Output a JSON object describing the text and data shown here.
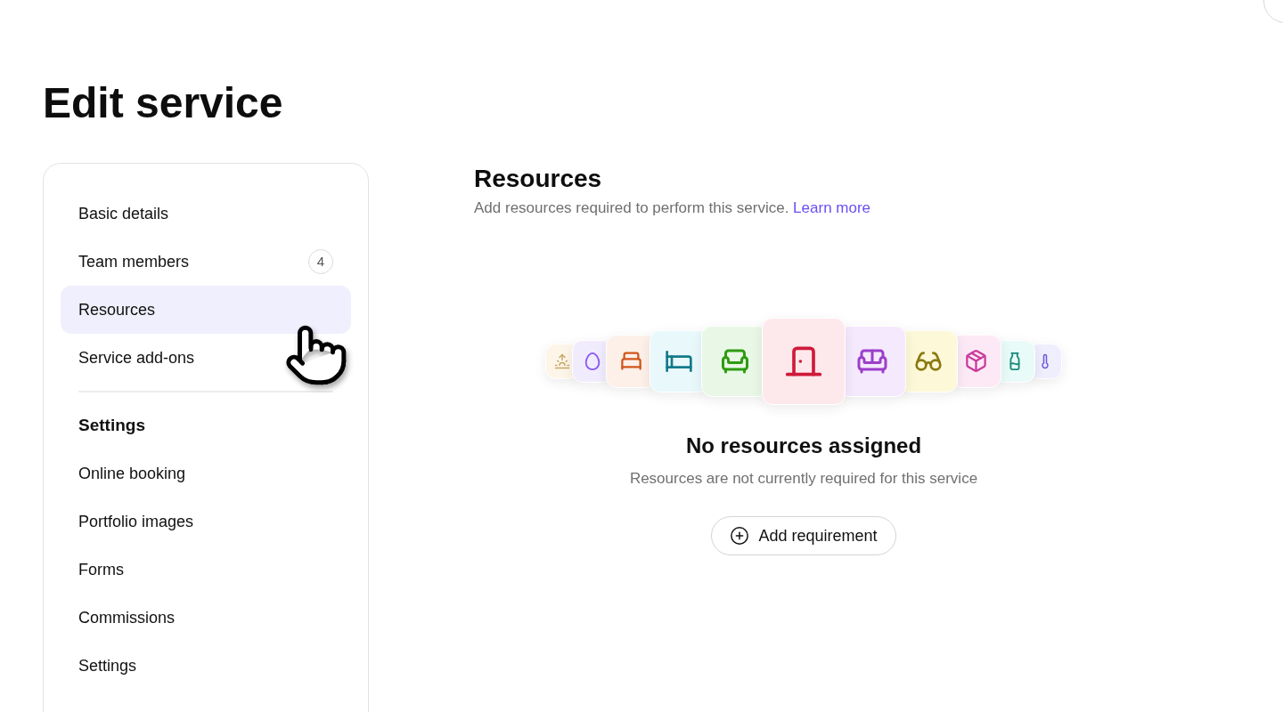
{
  "title": "Edit service",
  "nav": {
    "items": [
      {
        "label": "Basic details",
        "selected": false
      },
      {
        "label": "Team members",
        "badge": "4",
        "selected": false
      },
      {
        "label": "Resources",
        "selected": true
      },
      {
        "label": "Service add-ons",
        "selected": false
      }
    ],
    "section_heading": "Settings",
    "section_items": [
      {
        "label": "Online booking",
        "selected": false
      },
      {
        "label": "Portfolio images",
        "selected": false
      },
      {
        "label": "Forms",
        "selected": false
      },
      {
        "label": "Commissions",
        "selected": false
      },
      {
        "label": "Settings",
        "selected": false
      }
    ]
  },
  "content": {
    "heading": "Resources",
    "subtitle": "Add resources required to perform this service.",
    "link": "Learn more",
    "empty_state": {
      "title": "No resources assigned",
      "text": "Resources are not currently required for this service",
      "button": "Add requirement"
    }
  }
}
